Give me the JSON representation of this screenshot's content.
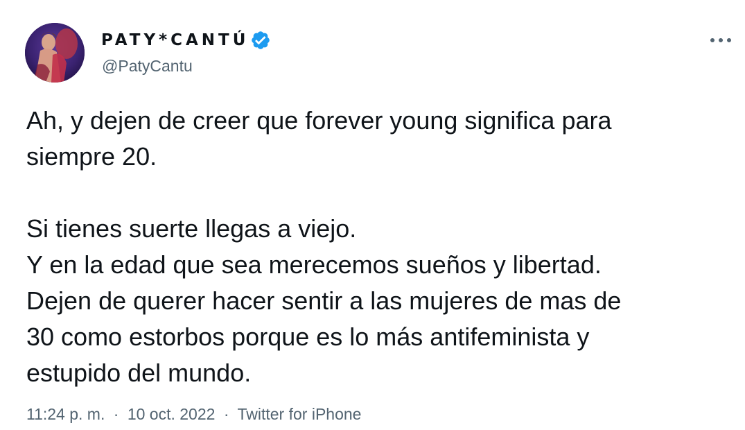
{
  "tweet": {
    "author": {
      "display_name": "PATY*CANTÚ",
      "handle": "@PatyCantu",
      "verified": true,
      "avatar_icon": "profile-photo"
    },
    "more_icon": "more-horizontal-icon",
    "text_lines": [
      "Ah, y dejen de creer que forever young significa para",
      "siempre 20.",
      "",
      "Si tienes suerte llegas a viejo.",
      "Y en la edad que sea merecemos sueños y libertad.",
      "Dejen de querer hacer sentir a las mujeres de mas de",
      "30 como estorbos porque es lo más antifeminista y",
      "estupido del mundo."
    ],
    "time": "11:24 p. m.",
    "date": "10 oct. 2022",
    "source": "Twitter for iPhone",
    "separator": "·"
  },
  "colors": {
    "text": "#0f1419",
    "secondary": "#536471",
    "verified_badge": "#1d9bf0",
    "background": "#ffffff"
  }
}
